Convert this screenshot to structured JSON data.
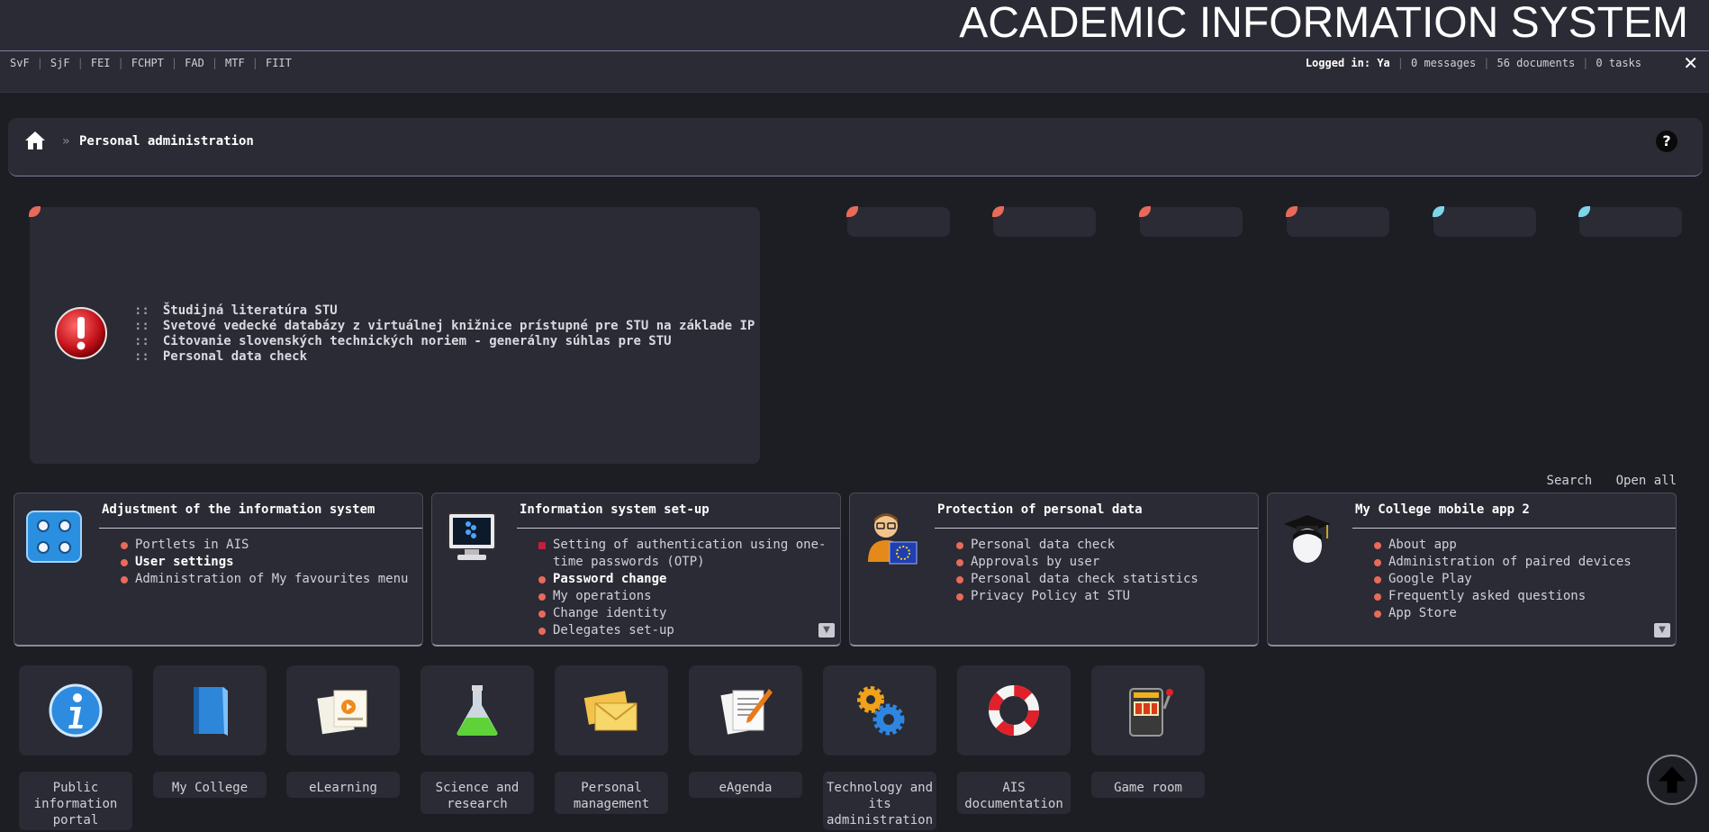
{
  "header": {
    "title": "ACADEMIC INFORMATION SYSTEM",
    "faculties": [
      "SvF",
      "SjF",
      "FEI",
      "FCHPT",
      "FAD",
      "MTF",
      "FIIT"
    ],
    "user": {
      "logged_label": "Logged in:",
      "user_name": "Ya",
      "messages": "0 messages",
      "documents": "56 documents",
      "tasks": "0 tasks"
    }
  },
  "breadcrumb": {
    "separator": "»",
    "current": "Personal administration",
    "help": "?"
  },
  "announcements": {
    "marker": "::",
    "items": [
      "Študijná literatúra STU",
      "Svetové vedecké databázy z virtuálnej knižnice prístupné pre STU na základe IP",
      "Citovanie slovenských technických noriem - generálny súhlas pre STU",
      "Personal data check"
    ]
  },
  "toolbar": {
    "search": "Search",
    "open_all": "Open all"
  },
  "panels": [
    {
      "title": "Adjustment of the information system",
      "items": [
        "Portlets in AIS",
        "User settings",
        "Administration of My favourites menu"
      ]
    },
    {
      "title": "Information system set-up",
      "items": [
        "Setting of authentication using one-time passwords (OTP)",
        "Password change",
        "My operations",
        "Change identity",
        "Delegates set-up"
      ]
    },
    {
      "title": "Protection of personal data",
      "items": [
        "Personal data check",
        "Approvals by user",
        "Personal data check statistics",
        "Privacy Policy at STU"
      ]
    },
    {
      "title": "My College mobile app 2",
      "items": [
        "About app",
        "Administration of paired devices",
        "Google Play",
        "Frequently asked questions",
        "App Store"
      ]
    }
  ],
  "tiles": [
    {
      "label": "Public information portal",
      "icon": "info-icon"
    },
    {
      "label": "My College",
      "icon": "book-icon"
    },
    {
      "label": "eLearning",
      "icon": "elearning-icon"
    },
    {
      "label": "Science and research",
      "icon": "flask-icon"
    },
    {
      "label": "Personal management",
      "icon": "envelopes-icon"
    },
    {
      "label": "eAgenda",
      "icon": "documents-icon"
    },
    {
      "label": "Technology and its administration",
      "icon": "gears-icon"
    },
    {
      "label": "AIS documentation",
      "icon": "lifebuoy-icon"
    },
    {
      "label": "Game room",
      "icon": "slot-machine-icon"
    }
  ],
  "colors": {
    "background": "#1d1e24",
    "panel": "#2a2b34",
    "bullet": "#e86a5a",
    "accent_line": "#7b7fa6",
    "corner_red": "#e86a5a",
    "corner_cyan": "#7fd6ea"
  }
}
